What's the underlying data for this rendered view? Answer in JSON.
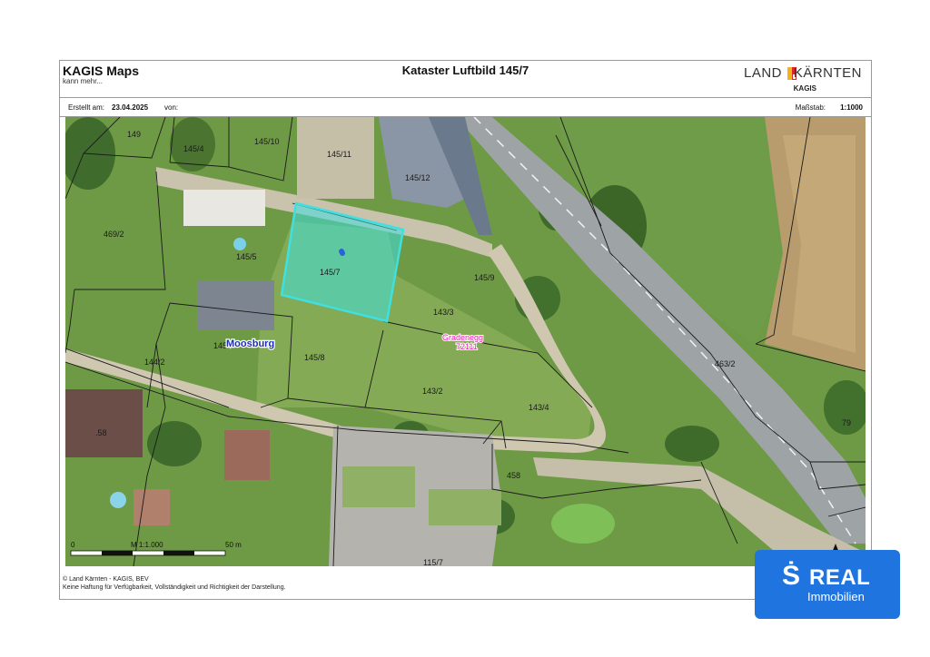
{
  "header": {
    "app_title": "KAGIS Maps",
    "app_subtitle": "kann mehr...",
    "map_title": "Kataster Luftbild 145/7",
    "logo": {
      "land": "LAND",
      "karnten": "KÄRNTEN",
      "kagis": "KAGIS",
      "colors": [
        "#f2b21b",
        "#d9262b"
      ]
    }
  },
  "meta": {
    "created_label": "Erstellt am:",
    "created_date": "23.04.2025",
    "von_label": "von:",
    "scale_label": "Maßstab:",
    "scale_value": "1:1000"
  },
  "map": {
    "parcels": {
      "p149": "149",
      "p145_4": "145/4",
      "p145_10": "145/10",
      "p145_11": "145/11",
      "p145_12": "145/12",
      "p469_2": "469/2",
      "p145_5": "145/5",
      "p145_7": "145/7",
      "p145_9": "145/9",
      "p143_3": "143/3",
      "p145_x": "145",
      "p145_8": "145/8",
      "p143_2": "143/2",
      "p143_4": "143/4",
      "p144_2": "144/2",
      "p463_2": "463/2",
      "p79": "79",
      "p58": ".58",
      "p458": "458",
      "p115_7": "115/7"
    },
    "place_moosburg": "Moosburg",
    "place_gradenegg": "Gradenegg",
    "place_code": "72111",
    "highlight_color": "#3fe0e0",
    "scalebar": {
      "zero": "0",
      "label": "M 1:1.000",
      "end": "50 m"
    },
    "north_icon": "north-arrow-icon"
  },
  "footer": {
    "line1": "© Land Kärnten - KAGIS, BEV",
    "line2": "Keine Haftung für Verfügbarkeit, Vollständigkeit und Richtigkeit der Darstellung."
  },
  "badge": {
    "s": "Ṡ",
    "real": "REAL",
    "immobilien": "Immobilien",
    "color": "#1f74e0"
  }
}
